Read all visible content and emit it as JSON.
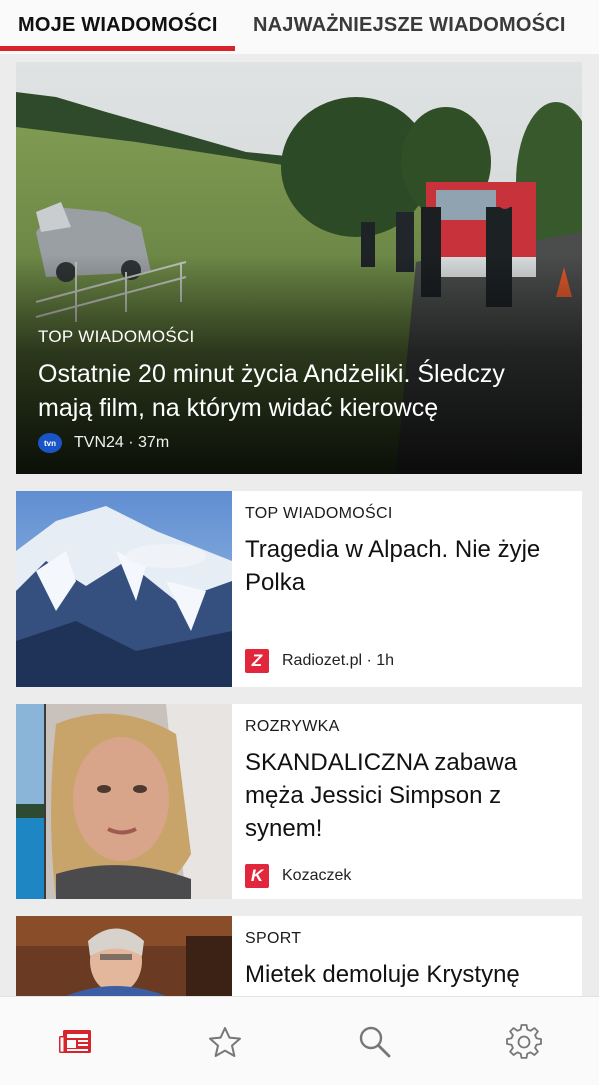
{
  "tabs": [
    {
      "label": "MOJE WIADOMOŚCI"
    },
    {
      "label": "NAJWAŻNIEJSZE WIADOMOŚCI"
    }
  ],
  "hero": {
    "category": "TOP WIADOMOŚCI",
    "title": "Ostatnie 20 minut życia Andżeliki. Śledczy mają film, na którym widać kierowcę",
    "source": "TVN24 · 37m",
    "source_logo_text": "tvn"
  },
  "cards": [
    {
      "category": "TOP WIADOMOŚCI",
      "title": "Tragedia w Alpach. Nie żyje Polka",
      "source": "Radiozet.pl · 1h",
      "source_logo_text": "Z"
    },
    {
      "category": "ROZRYWKA",
      "title": "SKANDALICZNA zabawa męża Jessici Simpson z synem!",
      "source": "Kozaczek",
      "source_logo_text": "K"
    },
    {
      "category": "SPORT",
      "title": "Mietek demoluje Krystynę"
    }
  ],
  "bottom_nav": [
    {
      "icon": "newspaper-icon",
      "active": true
    },
    {
      "icon": "star-icon"
    },
    {
      "icon": "search-icon"
    },
    {
      "icon": "gear-icon"
    }
  ],
  "colors": {
    "accent": "#d9232a",
    "background": "#ececec"
  }
}
